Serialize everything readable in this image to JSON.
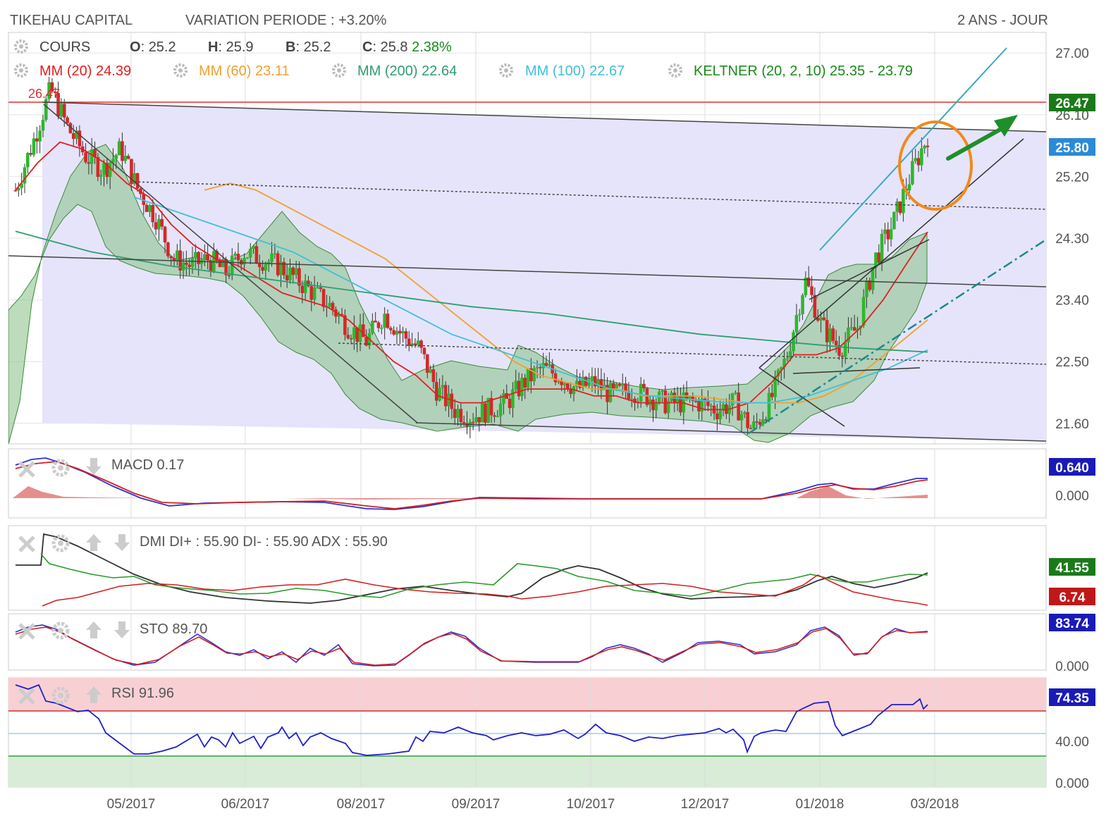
{
  "header": {
    "title": "TIKEHAU CAPITAL",
    "variation": "VARIATION PERIODE : +3.20%",
    "period": "2 ANS - JOUR"
  },
  "quote": {
    "label": "COURS",
    "o_label": "O",
    "o": "25.2",
    "h_label": "H",
    "h": "25.9",
    "b_label": "B",
    "b": "25.2",
    "c_label": "C",
    "c": "25.8",
    "change": "2.38%"
  },
  "indicators": [
    {
      "label": "MM (20)",
      "value": "24.39",
      "color": "#e02020"
    },
    {
      "label": "MM (60)",
      "value": "23.11",
      "color": "#f0a030"
    },
    {
      "label": "MM (200)",
      "value": "22.64",
      "color": "#2e9e6e"
    },
    {
      "label": "MM (100)",
      "value": "22.67",
      "color": "#40c0d8"
    },
    {
      "label": "KELTNER (20, 2, 10)",
      "value": "25.35 - 23.79",
      "color": "#1a8a1a"
    }
  ],
  "colors": {
    "up": "#2db82d",
    "down": "#d42828",
    "channel_fill": "#e6e4fb",
    "keltner_fill": "#8fc48f",
    "resistance": "#e03030",
    "arrow": "#1f8f2a",
    "circle": "#f08a1a"
  },
  "price_axis": {
    "ticks": [
      "27.00",
      "26.10",
      "25.20",
      "24.30",
      "23.40",
      "22.50",
      "21.60"
    ],
    "badges": [
      {
        "value": "26.47",
        "bg": "#1a7a1a"
      },
      {
        "value": "25.80",
        "bg": "#2a8ad8"
      }
    ],
    "resistance_label": "26.47"
  },
  "x_axis": {
    "labels": [
      "05/2017",
      "06/2017",
      "08/2017",
      "09/2017",
      "10/2017",
      "12/2017",
      "01/2018",
      "03/2018"
    ]
  },
  "panels": {
    "macd": {
      "label": "MACD",
      "value": "0.17",
      "badge": "0.640",
      "badge_bg": "#1a1ab8",
      "zero": "0.000"
    },
    "dmi": {
      "label": "DMI",
      "text": "DI+ : 55.90 DI- : 55.90 ADX : 55.90",
      "badge_green": "41.55",
      "badge_red": "6.74"
    },
    "sto": {
      "label": "STO",
      "value": "89.70",
      "badge": "83.74",
      "badge_bg": "#1a1ab8",
      "zero": "0.000"
    },
    "rsi": {
      "label": "RSI",
      "value": "91.96",
      "badge": "74.35",
      "badge_bg": "#1a1ab8",
      "mid": "40.00",
      "zero": "0.000"
    }
  },
  "chart_data": {
    "type": "line",
    "title": "TIKEHAU CAPITAL",
    "ylim": [
      21.3,
      27.3
    ],
    "y_ticks": [
      27.0,
      26.1,
      25.2,
      24.3,
      23.4,
      22.5,
      21.6
    ],
    "x_labels": [
      "05/2017",
      "06/2017",
      "08/2017",
      "09/2017",
      "10/2017",
      "12/2017",
      "01/2018",
      "03/2018"
    ],
    "series": [
      {
        "name": "COURS",
        "values": [
          25.0,
          25.7,
          26.47,
          25.9,
          25.5,
          25.3,
          25.6,
          25.0,
          24.6,
          24.0,
          23.9,
          24.0,
          23.8,
          24.1,
          24.0,
          23.9,
          23.7,
          23.5,
          23.3,
          23.0,
          22.8,
          23.2,
          22.9,
          22.7,
          22.1,
          21.8,
          21.7,
          21.8,
          21.9,
          22.2,
          22.4,
          22.3,
          22.1,
          22.2,
          22.0,
          22.1,
          22.0,
          21.9,
          21.9,
          21.9,
          21.8,
          21.9,
          21.5,
          21.9,
          22.6,
          23.7,
          23.0,
          22.7,
          23.0,
          24.0,
          24.5,
          25.2,
          25.8
        ]
      },
      {
        "name": "MM (20)",
        "values": [
          25.0,
          25.4,
          25.7,
          25.6,
          25.4,
          25.1,
          24.9,
          24.5,
          24.2,
          24.0,
          23.9,
          23.7,
          23.5,
          23.4,
          23.3,
          23.1,
          22.8,
          22.5,
          22.3,
          22.0,
          21.9,
          21.9,
          22.0,
          22.1,
          22.1,
          22.1,
          22.0,
          22.0,
          21.9,
          21.9,
          21.9,
          21.8,
          21.8,
          21.9,
          22.2,
          22.6,
          22.6,
          22.7,
          23.0,
          23.4,
          23.9,
          24.39
        ]
      },
      {
        "name": "MM (60)",
        "values": [
          25.0,
          25.1,
          25.0,
          24.8,
          24.6,
          24.4,
          24.2,
          24.0,
          23.7,
          23.4,
          23.1,
          22.8,
          22.5,
          22.3,
          22.2,
          22.1,
          22.1,
          22.0,
          22.0,
          22.0,
          21.95,
          21.9,
          21.9,
          21.9,
          22.0,
          22.2,
          22.5,
          22.8,
          23.11
        ]
      },
      {
        "name": "MM (100)",
        "values": [
          24.9,
          24.7,
          24.5,
          24.3,
          24.1,
          23.8,
          23.5,
          23.2,
          22.9,
          22.7,
          22.5,
          22.3,
          22.1,
          22.0,
          21.95,
          21.9,
          21.9,
          22.0,
          22.2,
          22.4,
          22.67
        ]
      },
      {
        "name": "MM (200)",
        "values": [
          24.4,
          24.1,
          23.9,
          23.75,
          23.6,
          23.45,
          23.3,
          23.2,
          23.05,
          22.9,
          22.8,
          22.7,
          22.64
        ]
      }
    ]
  }
}
